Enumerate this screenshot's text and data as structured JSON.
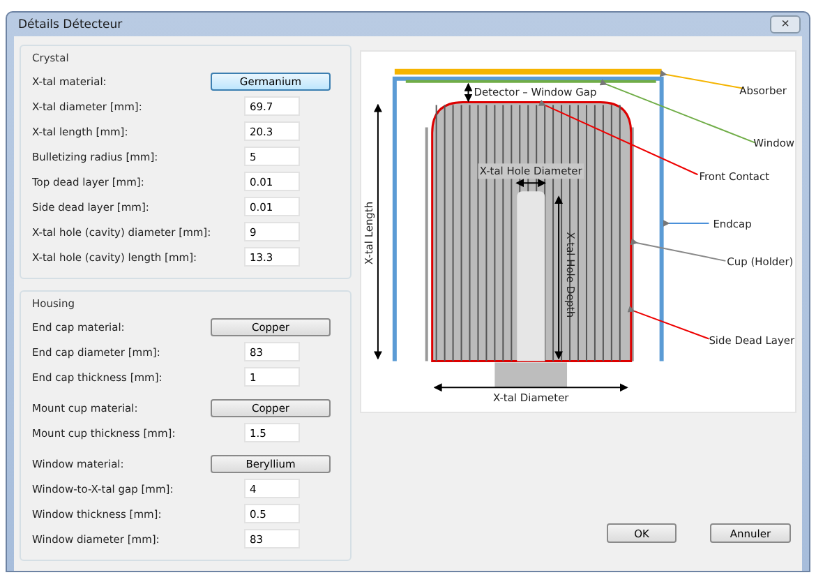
{
  "window": {
    "title": "Détails Détecteur",
    "close": "×"
  },
  "groups": [
    {
      "title": "Crystal",
      "rows": [
        {
          "kind": "button",
          "label": "X-tal material:",
          "value": "Germanium",
          "highlighted": true
        },
        {
          "kind": "field",
          "label": "X-tal diameter [mm]:",
          "value": "69.7"
        },
        {
          "kind": "field",
          "label": "X-tal length [mm]:",
          "value": "20.3"
        },
        {
          "kind": "field",
          "label": "Bulletizing radius [mm]:",
          "value": "5"
        },
        {
          "kind": "field",
          "label": "Top dead layer [mm]:",
          "value": "0.01"
        },
        {
          "kind": "field",
          "label": "Side dead layer [mm]:",
          "value": "0.01"
        },
        {
          "kind": "field",
          "label": "X-tal hole (cavity) diameter [mm]:",
          "value": "9"
        },
        {
          "kind": "field",
          "label": "X-tal hole (cavity) length [mm]:",
          "value": "13.3"
        }
      ]
    },
    {
      "title": "Housing",
      "rows": [
        {
          "kind": "button",
          "label": "End cap material:",
          "value": "Copper",
          "highlighted": false
        },
        {
          "kind": "field",
          "label": "End cap diameter [mm]:",
          "value": "83"
        },
        {
          "kind": "field",
          "label": "End cap thickness [mm]:",
          "value": "1"
        },
        {
          "kind": "button",
          "label": "Mount cup material:",
          "value": "Copper",
          "highlighted": false,
          "gap": true
        },
        {
          "kind": "field",
          "label": "Mount cup thickness [mm]:",
          "value": "1.5"
        },
        {
          "kind": "button",
          "label": "Window material:",
          "value": "Beryllium",
          "highlighted": false,
          "gap": true
        },
        {
          "kind": "field",
          "label": "Window-to-X-tal gap [mm]:",
          "value": "4"
        },
        {
          "kind": "field",
          "label": "Window thickness [mm]:",
          "value": "0.5"
        },
        {
          "kind": "field",
          "label": "Window diameter [mm]:",
          "value": "83"
        }
      ]
    }
  ],
  "diagram": {
    "labels": {
      "absorber": "Absorber",
      "window": "Window",
      "front_contact": "Front Contact",
      "endcap": "Endcap",
      "cup": "Cup (Holder)",
      "side_dead_layer": "Side Dead Layer"
    },
    "dimensions": {
      "gap": "Detector – Window Gap",
      "hole_diameter": "X-tal Hole Diameter",
      "length": "X-tal Length",
      "hole_depth": "X-tal Hole Depth",
      "diameter": "X-tal Diameter"
    }
  },
  "buttons": [
    "OK",
    "Annuler"
  ]
}
